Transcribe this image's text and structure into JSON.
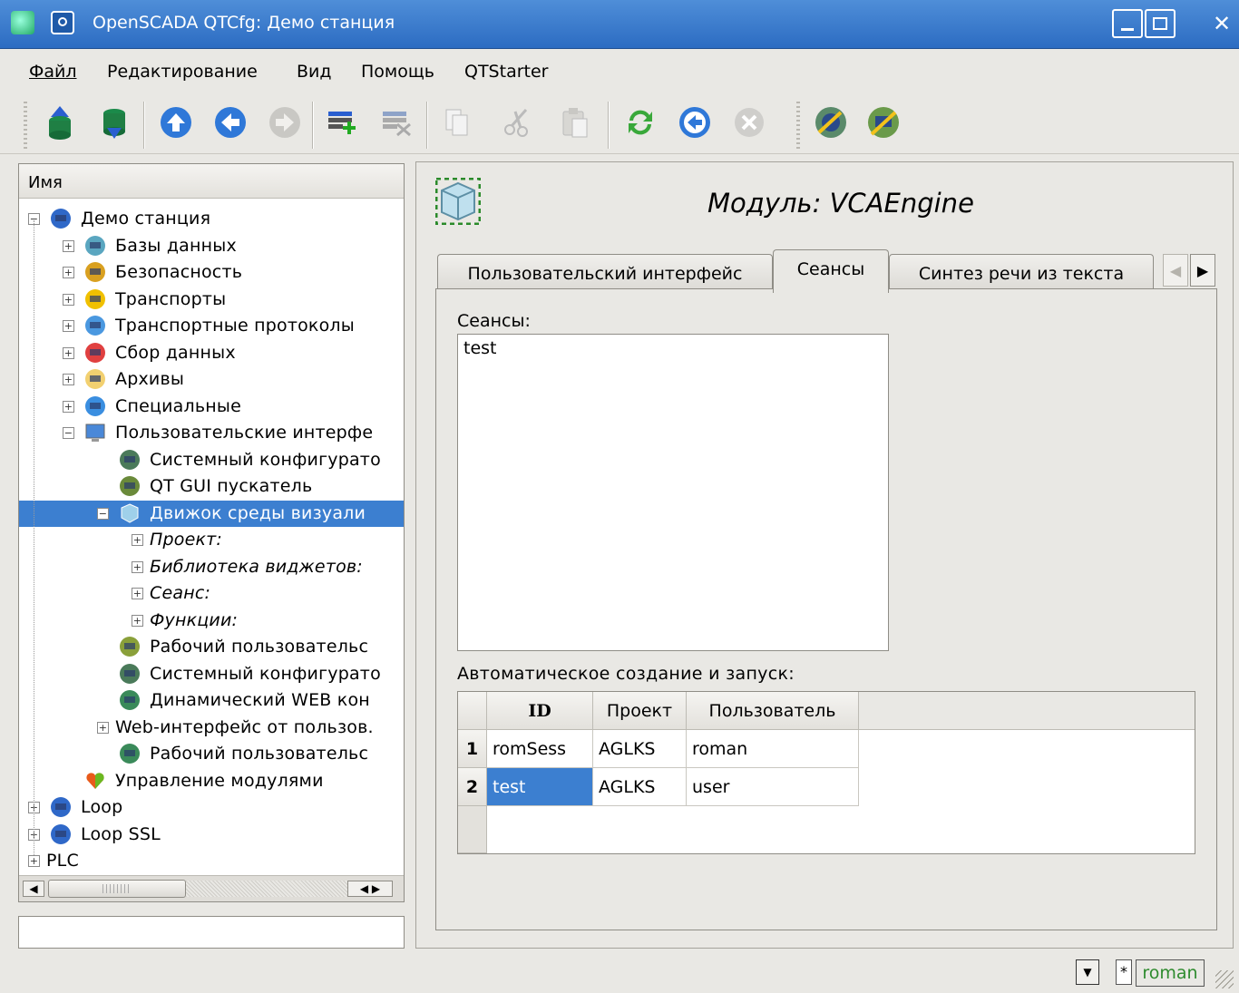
{
  "window": {
    "title": "OpenSCADA QTCfg: Демо станция",
    "controls": [
      "minimize",
      "maximize",
      "close"
    ]
  },
  "menu": [
    "Файл",
    "Редактирование",
    "Вид",
    "Помощь",
    "QTStarter"
  ],
  "toolbar": {
    "icons": [
      "db-load-icon",
      "db-save-icon",
      "up-icon",
      "back-icon",
      "forward-icon",
      "add-item-icon",
      "delete-item-icon",
      "copy-icon",
      "cut-icon",
      "paste-icon",
      "refresh-icon",
      "start-icon",
      "stop-icon",
      "qtcfg-icon",
      "uirun-icon"
    ]
  },
  "tree": {
    "header": "Имя",
    "items": [
      {
        "label": "Демо станция",
        "italic": false
      },
      {
        "label": "Базы данных",
        "italic": false
      },
      {
        "label": "Безопасность",
        "italic": false
      },
      {
        "label": "Транспорты",
        "italic": false
      },
      {
        "label": "Транспортные протоколы",
        "italic": false
      },
      {
        "label": "Сбор данных",
        "italic": false
      },
      {
        "label": "Архивы",
        "italic": false
      },
      {
        "label": "Специальные",
        "italic": false
      },
      {
        "label": "Пользовательские интерфе",
        "italic": false
      },
      {
        "label": "Системный конфигурато",
        "italic": false
      },
      {
        "label": "QT GUI пускатель",
        "italic": false
      },
      {
        "label": "Движок среды визуали",
        "italic": false,
        "selected": true
      },
      {
        "label": "Проект:",
        "italic": true
      },
      {
        "label": "Библиотека виджетов:",
        "italic": true
      },
      {
        "label": "Сеанс:",
        "italic": true
      },
      {
        "label": "Функции:",
        "italic": true
      },
      {
        "label": "Рабочий пользовательс",
        "italic": false
      },
      {
        "label": "Системный конфигурато",
        "italic": false
      },
      {
        "label": "Динамический WEB кон",
        "italic": false
      },
      {
        "label": "Web-интерфейс от пользов.",
        "italic": false
      },
      {
        "label": "Рабочий пользовательс",
        "italic": false
      },
      {
        "label": "Управление модулями",
        "italic": false
      },
      {
        "label": "Loop",
        "italic": false
      },
      {
        "label": "Loop SSL",
        "italic": false
      },
      {
        "label": "PLC",
        "italic": false
      }
    ]
  },
  "main": {
    "title": "Модуль: VCAEngine",
    "tabs": [
      "Пользовательский интерфейс",
      "Сеансы",
      "Синтез речи из текста"
    ],
    "active_tab": "Сеансы",
    "sessions_label": "Сеансы:",
    "sessions": [
      "test"
    ],
    "auto_label": "Автоматическое создание и запуск:",
    "table": {
      "columns": [
        "ID",
        "Проект",
        "Пользователь"
      ],
      "rows": [
        {
          "num": "1",
          "id": "romSess",
          "project": "AGLKS",
          "user": "roman"
        },
        {
          "num": "2",
          "id": "test",
          "project": "AGLKS",
          "user": "user"
        }
      ]
    }
  },
  "status": {
    "star": "*",
    "user": "roman"
  },
  "colors": {
    "selection": "#3c7fd0",
    "titlebar": "#3a7bd0",
    "user_badge": "#2e8b2e"
  }
}
